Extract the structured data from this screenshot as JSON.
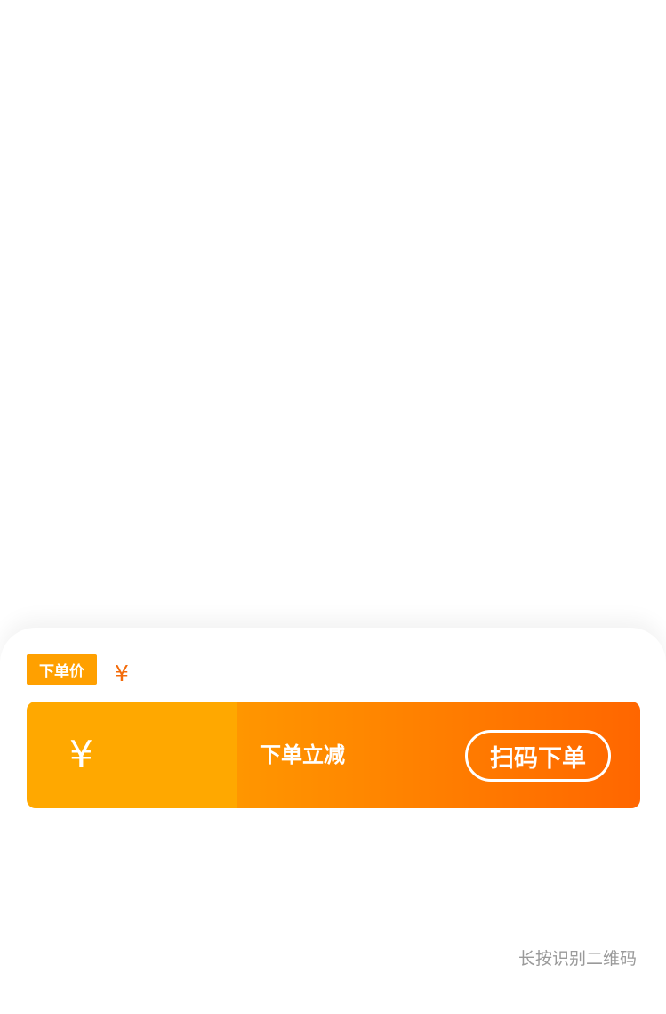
{
  "price": {
    "tag_label": "下单价",
    "currency_symbol": "¥"
  },
  "coupon": {
    "currency_symbol": "¥",
    "discount_label": "下单立减",
    "scan_button_label": "扫码下单"
  },
  "qr_hint": "长按识别二维码",
  "colors": {
    "tag_bg": "#ffa000",
    "price_text": "#f36b0a",
    "coupon_left_bg": "#ffa800",
    "coupon_gradient_start": "#ff9600",
    "coupon_gradient_end": "#ff6600",
    "hint_text": "#9a9a9a"
  }
}
